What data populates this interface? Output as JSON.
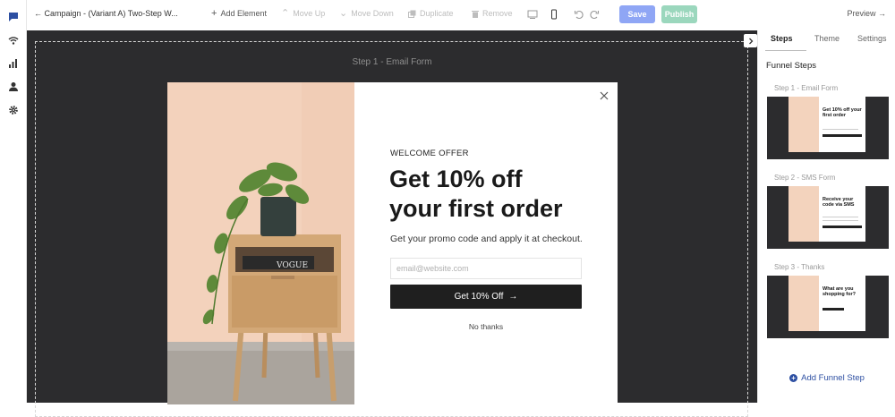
{
  "header": {
    "back_label": "← Campaign - (Variant A) Two-Step W...",
    "toolbar": {
      "add_element": "Add Element",
      "move_up": "Move Up",
      "move_down": "Move Down",
      "duplicate": "Duplicate",
      "remove": "Remove",
      "save": "Save",
      "publish": "Publish",
      "preview": "Preview →"
    },
    "colors": {
      "save_bg": "#8fa6f5",
      "publish_bg": "#9bd7bd"
    }
  },
  "canvas": {
    "step_label": "Step 1 - Email Form"
  },
  "popup": {
    "eyebrow": "WELCOME OFFER",
    "headline_line1": "Get 10% off",
    "headline_line2": "your first order",
    "subtext": "Get your promo code and apply it at checkout.",
    "email_placeholder": "email@website.com",
    "cta_label": "Get 10% Off",
    "cta_arrow": "→",
    "decline_label": "No thanks",
    "magazine_text": "VOGUE"
  },
  "panel": {
    "tabs": [
      "Steps",
      "Theme",
      "Settings"
    ],
    "title": "Funnel Steps",
    "steps": [
      {
        "name": "Step 1 - Email Form",
        "thumb_text": "Get 10% off your first order"
      },
      {
        "name": "Step 2 - SMS Form",
        "thumb_text": "Receive your code via SMS"
      },
      {
        "name": "Step 3 - Thanks",
        "thumb_text": "What are you shopping for?"
      }
    ],
    "add_step": "Add Funnel Step"
  }
}
